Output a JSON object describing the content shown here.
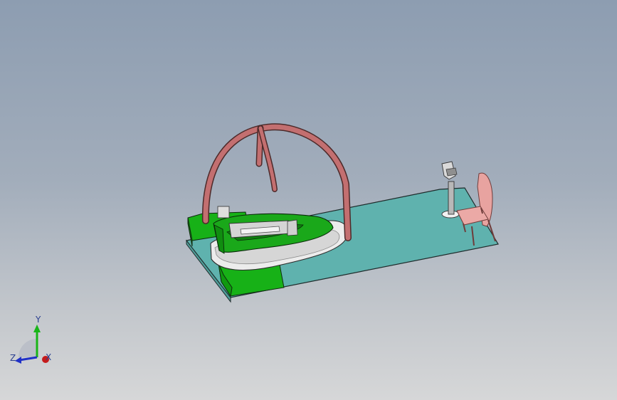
{
  "viewport": {
    "background_top": "#8d9db1",
    "background_bottom": "#d6d7d8"
  },
  "colors": {
    "floor": "#5fb2ae",
    "platform_green": "#17b117",
    "arch": "#c36f70",
    "chair": "#e8a3a0",
    "ride_base": "#e7e7e7"
  },
  "triad": {
    "x_label": "X",
    "y_label": "Y",
    "z_label": "Z",
    "icons": [
      "triad-y-arrow",
      "triad-z-arrow",
      "triad-x-origin"
    ]
  }
}
